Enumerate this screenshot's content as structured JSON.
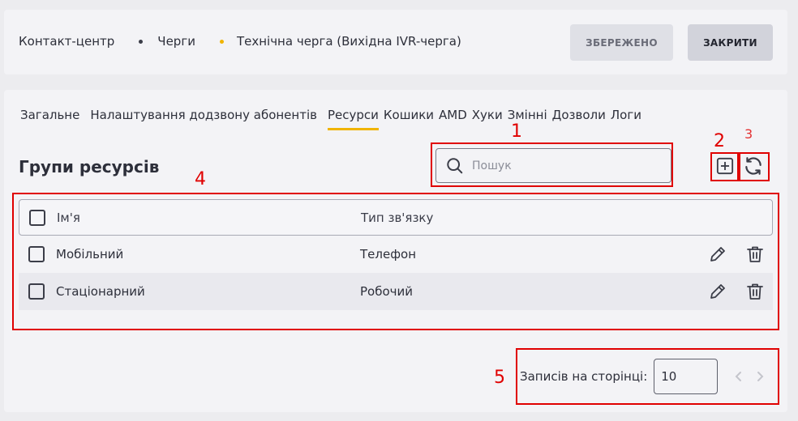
{
  "breadcrumb": {
    "item1": "Контакт-центр",
    "item2": "Черги",
    "item3": "Технічна черга (Вихідна IVR-черга)"
  },
  "header": {
    "saved_label": "ЗБЕРЕЖЕНО",
    "close_label": "ЗАКРИТИ"
  },
  "tabs": [
    {
      "label": "Загальне"
    },
    {
      "label": "Налаштування додзвону абонентів"
    },
    {
      "label": "Ресурси",
      "active": true
    },
    {
      "label": "Кошики"
    },
    {
      "label": "AMD"
    },
    {
      "label": "Хуки"
    },
    {
      "label": "Змінні"
    },
    {
      "label": "Дозволи"
    },
    {
      "label": "Логи"
    }
  ],
  "section": {
    "title": "Групи ресурсів"
  },
  "search": {
    "placeholder": "Пошук"
  },
  "table": {
    "headers": {
      "name": "Ім'я",
      "type": "Тип зв'язку"
    },
    "rows": [
      {
        "name": "Мобільний",
        "type": "Телефон"
      },
      {
        "name": "Стаціонарний",
        "type": "Робочий"
      }
    ]
  },
  "pagination": {
    "label": "Записів на сторінці:",
    "per_page": "10"
  },
  "annotations": {
    "a1": "1",
    "a2": "2",
    "a3": "3",
    "a4": "4",
    "a5": "5"
  },
  "colors": {
    "accent": "#f0b400",
    "annotation": "#e00000"
  },
  "icons": {
    "search": "search-icon",
    "add": "add-icon",
    "refresh": "refresh-icon",
    "edit": "pencil-icon",
    "delete": "trash-icon",
    "prev": "chevron-left-icon",
    "next": "chevron-right-icon"
  }
}
